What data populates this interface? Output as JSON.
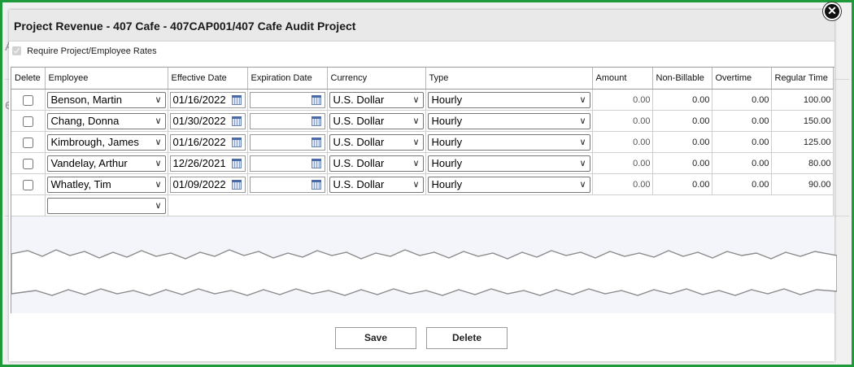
{
  "dialog": {
    "title": "Project Revenue - 407 Cafe - 407CAP001/407 Cafe Audit Project",
    "require_rates_label": "Require Project/Employee Rates",
    "require_rates_checked": true
  },
  "columns": {
    "delete": "Delete",
    "employee": "Employee",
    "effective_date": "Effective Date",
    "expiration_date": "Expiration Date",
    "currency": "Currency",
    "type": "Type",
    "amount": "Amount",
    "non_billable": "Non-Billable",
    "overtime": "Overtime",
    "regular_time": "Regular Time"
  },
  "rows": [
    {
      "employee": "Benson, Martin",
      "effective": "01/16/2022",
      "expiration": "",
      "currency": "U.S. Dollar",
      "type": "Hourly",
      "amount": "0.00",
      "non_billable": "0.00",
      "overtime": "0.00",
      "regular": "100.00"
    },
    {
      "employee": "Chang, Donna",
      "effective": "01/30/2022",
      "expiration": "",
      "currency": "U.S. Dollar",
      "type": "Hourly",
      "amount": "0.00",
      "non_billable": "0.00",
      "overtime": "0.00",
      "regular": "150.00"
    },
    {
      "employee": "Kimbrough, James",
      "effective": "01/16/2022",
      "expiration": "",
      "currency": "U.S. Dollar",
      "type": "Hourly",
      "amount": "0.00",
      "non_billable": "0.00",
      "overtime": "0.00",
      "regular": "125.00"
    },
    {
      "employee": "Vandelay, Arthur",
      "effective": "12/26/2021",
      "expiration": "",
      "currency": "U.S. Dollar",
      "type": "Hourly",
      "amount": "0.00",
      "non_billable": "0.00",
      "overtime": "0.00",
      "regular": "80.00"
    },
    {
      "employee": "Whatley, Tim",
      "effective": "01/09/2022",
      "expiration": "",
      "currency": "U.S. Dollar",
      "type": "Hourly",
      "amount": "0.00",
      "non_billable": "0.00",
      "overtime": "0.00",
      "regular": "90.00"
    }
  ],
  "new_row": {
    "employee": ""
  },
  "buttons": {
    "save": "Save",
    "delete": "Delete"
  },
  "colors": {
    "frame": "#1f9a3a",
    "header_bg": "#e9e9e9",
    "grid_bg": "#f4f5fa"
  },
  "icons": {
    "close": "close-icon",
    "calendar": "calendar-icon",
    "dropdown": "chevron-down-icon"
  }
}
